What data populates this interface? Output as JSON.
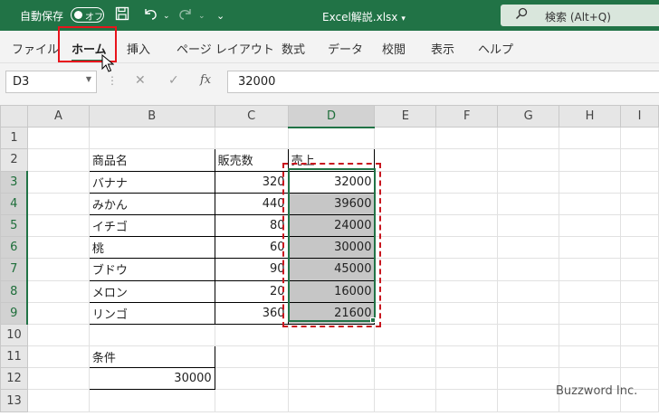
{
  "titlebar": {
    "autosave_label": "自動保存",
    "toggle_label": "オフ",
    "filename": "Excel解説.xlsx",
    "search_placeholder": "検索 (Alt+Q)"
  },
  "ribbon": {
    "tabs": [
      "ファイル",
      "ホーム",
      "挿入",
      "ページ レイアウト",
      "数式",
      "データ",
      "校閲",
      "表示",
      "ヘルプ"
    ],
    "active_tab": "ホーム"
  },
  "formula_bar": {
    "name_box": "D3",
    "fx": "fx",
    "value": "32000"
  },
  "sheet": {
    "columns": [
      "A",
      "B",
      "C",
      "D",
      "E",
      "F",
      "G",
      "H",
      "I"
    ],
    "rows": [
      "1",
      "2",
      "3",
      "4",
      "5",
      "6",
      "7",
      "8",
      "9",
      "10",
      "11",
      "12",
      "13"
    ],
    "selected_column": "D",
    "selected_rows": [
      "3",
      "4",
      "5",
      "6",
      "7",
      "8",
      "9"
    ],
    "table_header": [
      "商品名",
      "販売数",
      "売上"
    ],
    "table_rows": [
      [
        "バナナ",
        "320",
        "32000"
      ],
      [
        "みかん",
        "440",
        "39600"
      ],
      [
        "イチゴ",
        "80",
        "24000"
      ],
      [
        "桃",
        "60",
        "30000"
      ],
      [
        "ブドウ",
        "90",
        "45000"
      ],
      [
        "メロン",
        "20",
        "16000"
      ],
      [
        "リンゴ",
        "360",
        "21600"
      ]
    ],
    "condition_label": "条件",
    "condition_value": "30000"
  },
  "watermark": "Buzzword Inc.",
  "colors": {
    "excel_green": "#217346",
    "highlight_red": "#e8141c",
    "selection_gray": "#c6c6c6"
  }
}
